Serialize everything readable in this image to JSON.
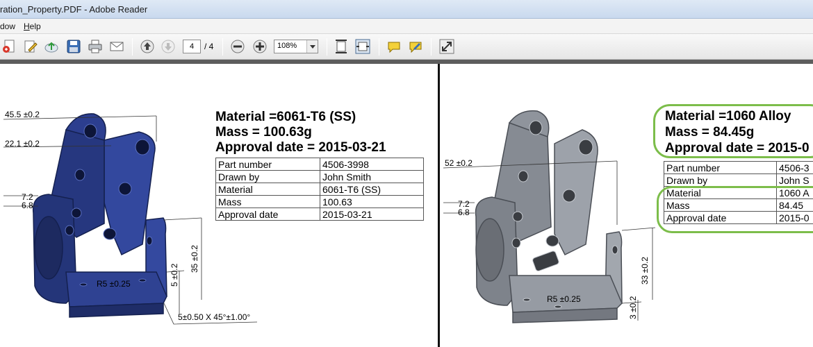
{
  "window": {
    "title": "ration_Property.PDF - Adobe Reader"
  },
  "menu": {
    "items": [
      {
        "prefix": "",
        "underlined": "",
        "rest": "dow"
      },
      {
        "prefix": "",
        "underlined": "H",
        "rest": "elp"
      }
    ]
  },
  "toolbar": {
    "page_current": "4",
    "page_total": "/ 4",
    "zoom": "108%",
    "icons": [
      "create-pdf-icon",
      "edit-icon",
      "upload-cloud-icon",
      "save-icon",
      "print-icon",
      "email-icon",
      "page-up-icon",
      "page-down-icon",
      "zoom-out-icon",
      "zoom-in-icon",
      "fit-page-icon",
      "fit-width-icon",
      "comment-icon",
      "sign-icon",
      "fullscreen-icon"
    ]
  },
  "left": {
    "heading": {
      "material": "Material =6061-T6 (SS)",
      "mass": "Mass =  100.63g",
      "approval": "Approval date = 2015-03-21"
    },
    "table": [
      [
        "Part number",
        "4506-3998"
      ],
      [
        "Drawn by",
        "John Smith"
      ],
      [
        "Material",
        "6061-T6 (SS)"
      ],
      [
        "Mass",
        "100.63"
      ],
      [
        "Approval date",
        "2015-03-21"
      ]
    ],
    "dims": {
      "d1": "45.5 ±0.2",
      "d2": "22.1 ±0.2",
      "d3": "7.2",
      "d4": "6.8",
      "d5": "R5 ±0.25",
      "d6": "5 ±0.2",
      "d7": "35 ±0.2",
      "d8": "5±0.50  X 45°±1.00°"
    },
    "part_color": "#2c3e8f"
  },
  "right": {
    "heading": {
      "material": "Material =1060 Alloy",
      "mass": "Mass =  84.45g",
      "approval": "Approval date = 2015-0"
    },
    "table": [
      [
        "Part number",
        "4506-3"
      ],
      [
        "Drawn by",
        "John S"
      ],
      [
        "Material",
        "1060 A"
      ],
      [
        "Mass",
        "84.45"
      ],
      [
        "Approval date",
        "2015-0"
      ]
    ],
    "dims": {
      "d1": "52 ±0.2",
      "d3": "7.2",
      "d4": "6.8",
      "d5": "R5 ±0.25",
      "d6": "3 ±0.2",
      "d7": "33 ±0.2"
    },
    "part_color": "#8f949c",
    "highlight_color": "#7cbd4a"
  }
}
